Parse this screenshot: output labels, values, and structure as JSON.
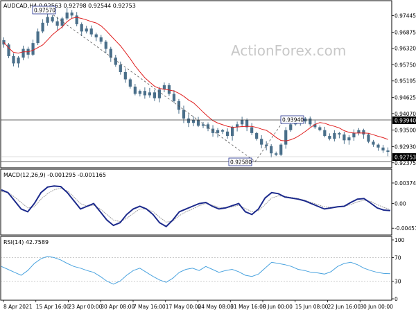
{
  "watermark": "ActionForex.com",
  "colors": {
    "candle": "#4a6f8a",
    "ma": "#e02020",
    "trendline": "#555555",
    "level": "#333333",
    "macd": "#1c2a8c",
    "signal": "#a0a0a0",
    "rsi": "#4aa3df",
    "border": "#000000",
    "label_bg_dark": "#000000",
    "label_fg_dark": "#ffffff"
  },
  "chart_data": [
    {
      "type": "candlestick",
      "header": "AUDCAD,H4  0.92563 0.92798 0.92544 0.92753",
      "y_ticks": [
        "0.97445",
        "0.96875",
        "0.96320",
        "0.95750",
        "0.95195",
        "0.94625",
        "0.94070",
        "0.93500",
        "0.92930",
        "0.92375"
      ],
      "y_range": [
        0.9225,
        0.9765
      ],
      "current_price": "0.92753",
      "level_line": "0.93940",
      "annotations": [
        {
          "text": "0.97570"
        },
        {
          "text": "0.93940"
        },
        {
          "text": "0.92580"
        }
      ],
      "series": [
        {
          "name": "MA",
          "kind": "moving-average"
        }
      ],
      "closes": [
        0.9645,
        0.9605,
        0.958,
        0.96,
        0.963,
        0.961,
        0.965,
        0.969,
        0.972,
        0.974,
        0.9725,
        0.971,
        0.9735,
        0.9755,
        0.9745,
        0.9715,
        0.969,
        0.97,
        0.968,
        0.967,
        0.9655,
        0.963,
        0.96,
        0.9575,
        0.955,
        0.9525,
        0.95,
        0.9475,
        0.9485,
        0.947,
        0.948,
        0.946,
        0.949,
        0.9505,
        0.9475,
        0.945,
        0.942,
        0.939,
        0.9375,
        0.9385,
        0.9365,
        0.937,
        0.9355,
        0.934,
        0.935,
        0.9345,
        0.933,
        0.936,
        0.937,
        0.9385,
        0.936,
        0.934,
        0.932,
        0.93,
        0.9295,
        0.927,
        0.9265,
        0.93,
        0.935,
        0.937,
        0.9375,
        0.938,
        0.939,
        0.937,
        0.936,
        0.935,
        0.933,
        0.932,
        0.934,
        0.9335,
        0.9315,
        0.9325,
        0.934,
        0.935,
        0.9335,
        0.931,
        0.93,
        0.929,
        0.928,
        0.9275
      ]
    },
    {
      "type": "line",
      "header": "MACD(12,26,9) -0.001295 -0.001165",
      "y_ticks": [
        "0.003747",
        "0.00",
        "-0.004514"
      ],
      "y_range": [
        -0.0055,
        0.0045
      ],
      "series": [
        {
          "name": "MACD",
          "values": [
            0.0025,
            0.002,
            0.0005,
            -0.001,
            -0.0015,
            0.0,
            0.002,
            0.003,
            0.0032,
            0.0031,
            0.002,
            0.0005,
            -0.001,
            -0.0005,
            0.0,
            -0.0015,
            -0.003,
            -0.004,
            -0.0035,
            -0.002,
            -0.001,
            -0.0005,
            -0.001,
            -0.002,
            -0.0035,
            -0.0042,
            -0.003,
            -0.0015,
            -0.001,
            -0.0005,
            0.0,
            0.0002,
            -0.0005,
            -0.001,
            -0.0008,
            -0.0004,
            0.0,
            -0.0015,
            -0.002,
            -0.001,
            0.001,
            0.002,
            0.0018,
            0.0012,
            0.001,
            0.0008,
            0.0005,
            0.0,
            -0.0005,
            -0.001,
            -0.0008,
            -0.0006,
            -0.0005,
            0.0002,
            0.0008,
            0.0009,
            0.0001,
            -0.0008,
            -0.0012,
            -0.0013
          ]
        },
        {
          "name": "Signal",
          "values": [
            0.0022,
            0.002,
            0.0012,
            0.0002,
            -0.0008,
            -0.0006,
            0.0008,
            0.0018,
            0.0025,
            0.0028,
            0.0023,
            0.0012,
            0.0,
            -0.0005,
            -0.0003,
            -0.001,
            -0.002,
            -0.003,
            -0.0033,
            -0.0027,
            -0.0018,
            -0.001,
            -0.001,
            -0.0015,
            -0.0025,
            -0.0034,
            -0.0032,
            -0.0022,
            -0.0015,
            -0.001,
            -0.0004,
            0.0,
            -0.0003,
            -0.0007,
            -0.0008,
            -0.0006,
            -0.0003,
            -0.0009,
            -0.0015,
            -0.0013,
            -0.0002,
            0.001,
            0.0014,
            0.0013,
            0.0011,
            0.0009,
            0.0006,
            0.0002,
            -0.0002,
            -0.0006,
            -0.0007,
            -0.0006,
            -0.0005,
            -0.0002,
            0.0003,
            0.0006,
            0.0004,
            -0.0002,
            -0.0007,
            -0.0011
          ]
        }
      ]
    },
    {
      "type": "line",
      "header": "RSI(14) 42.7589",
      "y_ticks": [
        "100",
        "70",
        "30",
        "0"
      ],
      "y_range": [
        0,
        100
      ],
      "series": [
        {
          "name": "RSI",
          "values": [
            55,
            50,
            45,
            40,
            48,
            60,
            68,
            72,
            70,
            66,
            60,
            55,
            52,
            48,
            45,
            38,
            30,
            25,
            30,
            40,
            48,
            52,
            45,
            38,
            32,
            28,
            35,
            45,
            50,
            52,
            48,
            55,
            50,
            45,
            48,
            50,
            46,
            40,
            38,
            42,
            52,
            62,
            60,
            58,
            55,
            50,
            48,
            45,
            44,
            42,
            46,
            55,
            60,
            62,
            58,
            52,
            48,
            45,
            43,
            42.7589
          ]
        }
      ]
    }
  ],
  "x_axis_labels": [
    "8 Apr 2021",
    "15 Apr 16:00",
    "23 Apr 00:00",
    "30 Apr 08:00",
    "7 May 16:00",
    "17 May 00:00",
    "24 May 08:00",
    "31 May 16:00",
    "8 Jun 00:00",
    "15 Jun 08:00",
    "22 Jun 16:00",
    "30 Jun 00:00"
  ]
}
